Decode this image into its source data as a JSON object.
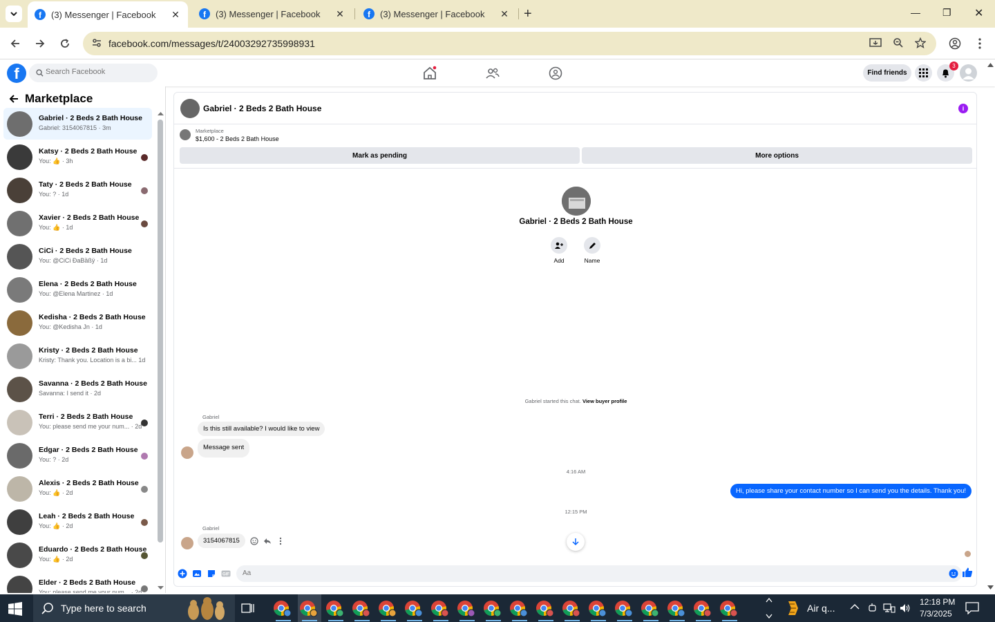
{
  "browser": {
    "tabs": [
      {
        "title": "(3) Messenger | Facebook",
        "active": true
      },
      {
        "title": "(3) Messenger | Facebook",
        "active": false
      },
      {
        "title": "(3) Messenger | Facebook",
        "active": false
      }
    ],
    "url": "facebook.com/messages/t/24003292735998931"
  },
  "fb": {
    "search_placeholder": "Search Facebook",
    "find_friends": "Find friends",
    "notif_count": "3"
  },
  "sidebar": {
    "title": "Marketplace",
    "conversations": [
      {
        "name": "Gabriel · 2 Beds 2 Bath House",
        "preview": "Gabriel: 3154067815 · 3m",
        "selected": true
      },
      {
        "name": "Katsy · 2 Beds 2 Bath House",
        "preview": "You: 👍 · 3h"
      },
      {
        "name": "Taty · 2 Beds 2 Bath House",
        "preview": "You: ? · 1d"
      },
      {
        "name": "Xavier · 2 Beds 2 Bath House",
        "preview": "You: 👍 · 1d"
      },
      {
        "name": "CiCi · 2 Beds 2 Bath House",
        "preview": "You: @CiCi ĐaBầßÿ · 1d"
      },
      {
        "name": "Elena · 2 Beds 2 Bath House",
        "preview": "You: @Elena Martinez · 1d"
      },
      {
        "name": "Kedisha · 2 Beds 2 Bath House",
        "preview": "You: @Kedisha Jn · 1d"
      },
      {
        "name": "Kristy · 2 Beds 2 Bath House",
        "preview": "Kristy: Thank you. Location is a bi...    1d"
      },
      {
        "name": "Savanna · 2 Beds 2 Bath House",
        "preview": "Savanna: I send it · 2d"
      },
      {
        "name": "Terri · 2 Beds 2 Bath House",
        "preview": "You: please send me your num... · 2d"
      },
      {
        "name": "Edgar · 2 Beds 2 Bath House",
        "preview": "You: ? · 2d"
      },
      {
        "name": "Alexis · 2 Beds 2 Bath House",
        "preview": "You: 👍 · 2d"
      },
      {
        "name": "Leah · 2 Beds 2 Bath House",
        "preview": "You: 👍 · 2d"
      },
      {
        "name": "Eduardo · 2 Beds 2 Bath House",
        "preview": "You: 👍 · 2d"
      },
      {
        "name": "Elder · 2 Beds 2 Bath House",
        "preview": "You: please send me your num... · 2d"
      }
    ]
  },
  "chat": {
    "title": "Gabriel · 2 Beds 2 Bath House",
    "listing_label": "Marketplace",
    "listing_title": "$1,600 - 2 Beds 2 Bath House",
    "mark_pending": "Mark as pending",
    "more_options": "More options",
    "profile_name": "Gabriel · 2 Beds 2 Bath House",
    "add_label": "Add",
    "name_label": "Name",
    "started_text": "Gabriel started this chat.",
    "view_buyer": "View buyer profile",
    "sender1": "Gabriel",
    "msg1": "Is this still available? I would like to view",
    "msg2": "Message sent",
    "time1": "4:16 AM",
    "my_msg": "Hi, please share your contact number so I can send you the details. Thank you!",
    "time2": "12:15 PM",
    "sender2": "Gabriel",
    "msg3": "3154067815",
    "composer_placeholder": "Aa"
  },
  "taskbar": {
    "search_text": "Type here to search",
    "weather": "Air q...",
    "time": "12:18 PM",
    "date": "7/3/2025"
  },
  "colors": {
    "fb_blue": "#1877f2",
    "messenger_blue": "#0866ff",
    "tab_bg": "#efe9c9"
  }
}
